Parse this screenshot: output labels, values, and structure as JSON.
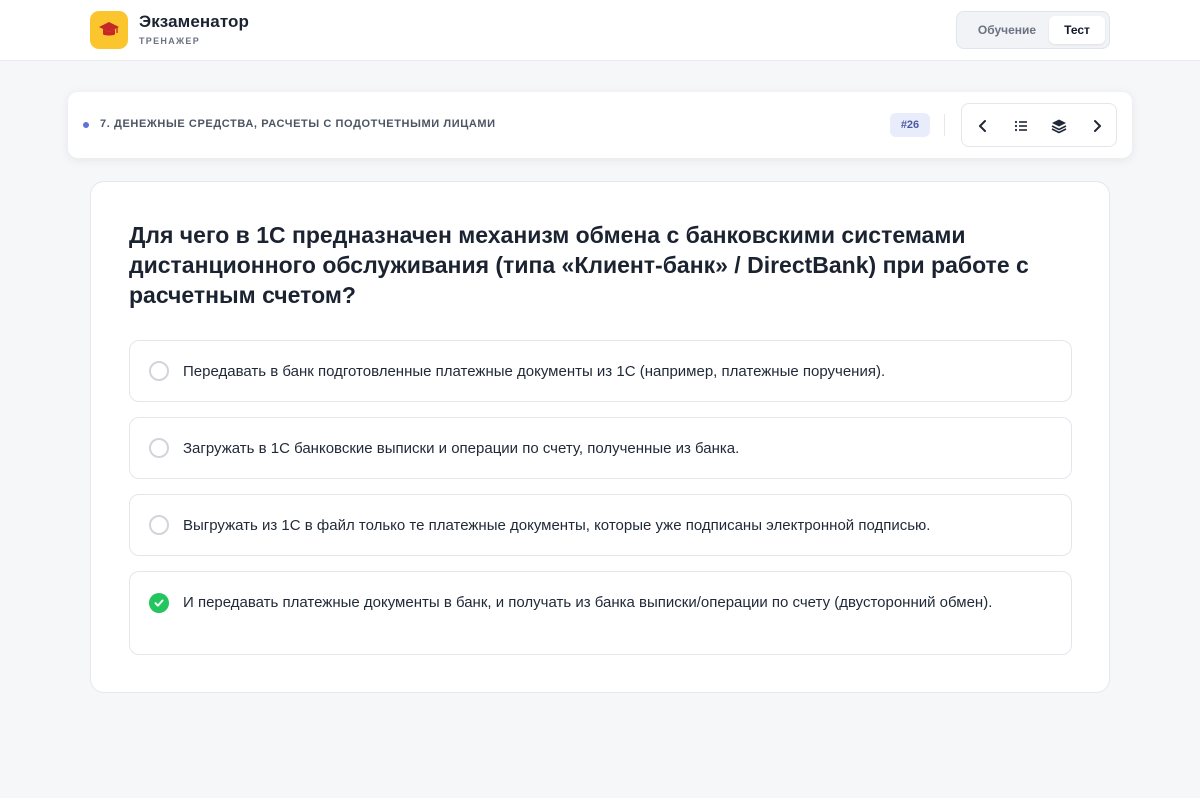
{
  "header": {
    "app_title": "Экзаменатор",
    "app_subtitle": "ТРЕНАЖЕР",
    "logo_icon": "graduation-cap-icon",
    "modes": [
      {
        "label": "Обучение",
        "active": false
      },
      {
        "label": "Тест",
        "active": true
      }
    ]
  },
  "topic": {
    "title": "7. ДЕНЕЖНЫЕ СРЕДСТВА, РАСЧЕТЫ С ПОДОТЧЕТНЫМИ ЛИЦАМИ",
    "question_number": "#26",
    "nav_icons": [
      "chevron-left-icon",
      "list-icon",
      "layers-icon",
      "chevron-right-icon"
    ]
  },
  "question": {
    "text": "Для чего в 1С предназначен механизм обмена с банковскими системами дистанционного обслуживания (типа «Клиент-банк» / DirectBank) при работе с расчетным счетом?",
    "options": [
      {
        "text": "Передавать в банк подготовленные платежные документы из 1С (например, платежные поручения).",
        "selected": false
      },
      {
        "text": "Загружать в 1С банковские выписки и операции по счету, полученные из банка.",
        "selected": false
      },
      {
        "text": "Выгружать из 1С в файл только те платежные документы, которые уже подписаны электронной подписью.",
        "selected": false
      },
      {
        "text": "И передавать платежные документы в банк, и получать из банка выписки/операции по счету (двусторонний обмен).",
        "selected": true
      }
    ]
  },
  "colors": {
    "accent_yellow": "#fbc52d",
    "correct_green": "#22c55e",
    "badge_bg": "#e9ecfb",
    "badge_text": "#4b5aa7"
  }
}
